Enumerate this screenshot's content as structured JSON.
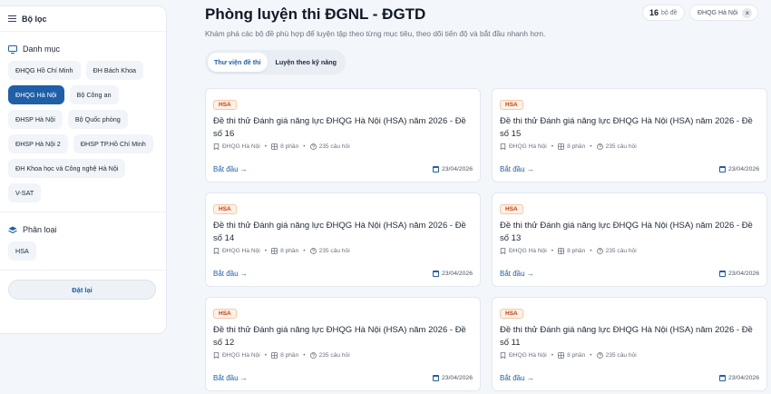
{
  "sidebar": {
    "header": "Bộ lọc",
    "category_title": "Danh mục",
    "categories": [
      {
        "label": "ĐHQG Hồ Chí Minh",
        "active": false
      },
      {
        "label": "ĐH Bách Khoa",
        "active": false
      },
      {
        "label": "ĐHQG Hà Nội",
        "active": true
      },
      {
        "label": "Bộ Công an",
        "active": false
      },
      {
        "label": "ĐHSP Hà Nội",
        "active": false
      },
      {
        "label": "Bộ Quốc phòng",
        "active": false
      },
      {
        "label": "ĐHSP Hà Nội 2",
        "active": false
      },
      {
        "label": "ĐHSP TP.Hồ Chí Minh",
        "active": false
      },
      {
        "label": "ĐH Khoa học và Công nghệ Hà Nội",
        "active": false
      },
      {
        "label": "V-SAT",
        "active": false
      }
    ],
    "classify_title": "Phân loại",
    "classify": [
      {
        "label": "HSA"
      }
    ],
    "reset_label": "Đặt lại"
  },
  "header": {
    "title": "Phòng luyện thi ĐGNL - ĐGTD",
    "subtitle": "Khám phá các bộ đề phù hợp để luyện tập theo từng mục tiêu, theo dõi tiến độ và bắt đầu nhanh hơn.",
    "count_value": "16",
    "count_unit": "bộ đề",
    "active_filter": "ĐHQG Hà Nội",
    "filter_close": "×"
  },
  "tabs": [
    {
      "label": "Thư viện đề thi",
      "active": true
    },
    {
      "label": "Luyện theo kỹ năng",
      "active": false
    }
  ],
  "cards": [
    {
      "tag": "HSA",
      "title": "Đề thi thử Đánh giá năng lực ĐHQG Hà Nội (HSA) năm 2026 - Đề số 16",
      "org": "ĐHQG Hà Nội",
      "parts": "8 phần",
      "questions": "235 câu hỏi",
      "start": "Bắt đầu →",
      "date": "23/04/2026"
    },
    {
      "tag": "HSA",
      "title": "Đề thi thử Đánh giá năng lực ĐHQG Hà Nội (HSA) năm 2026 - Đề số 15",
      "org": "ĐHQG Hà Nội",
      "parts": "8 phần",
      "questions": "235 câu hỏi",
      "start": "Bắt đầu →",
      "date": "23/04/2026"
    },
    {
      "tag": "HSA",
      "title": "Đề thi thử Đánh giá năng lực ĐHQG Hà Nội (HSA) năm 2026 - Đề số 14",
      "org": "ĐHQG Hà Nội",
      "parts": "8 phần",
      "questions": "235 câu hỏi",
      "start": "Bắt đầu →",
      "date": "23/04/2026"
    },
    {
      "tag": "HSA",
      "title": "Đề thi thử Đánh giá năng lực ĐHQG Hà Nội (HSA) năm 2026 - Đề số 13",
      "org": "ĐHQG Hà Nội",
      "parts": "8 phần",
      "questions": "235 câu hỏi",
      "start": "Bắt đầu →",
      "date": "23/04/2026"
    },
    {
      "tag": "HSA",
      "title": "Đề thi thử Đánh giá năng lực ĐHQG Hà Nội (HSA) năm 2026 - Đề số 12",
      "org": "ĐHQG Hà Nội",
      "parts": "8 phần",
      "questions": "235 câu hỏi",
      "start": "Bắt đầu →",
      "date": "23/04/2026"
    },
    {
      "tag": "HSA",
      "title": "Đề thi thử Đánh giá năng lực ĐHQG Hà Nội (HSA) năm 2026 - Đề số 11",
      "org": "ĐHQG Hà Nội",
      "parts": "8 phần",
      "questions": "235 câu hỏi",
      "start": "Bắt đầu →",
      "date": "23/04/2026"
    }
  ],
  "colors": {
    "accent": "#1f5fa8",
    "tag": "#c2410c",
    "background": "#f3f6fa"
  },
  "icons": {
    "filter": "menu-icon",
    "category": "monitor-icon",
    "classify": "layers-icon",
    "org": "bookmark-icon",
    "parts": "grid-icon",
    "questions": "help-circle-icon",
    "date": "calendar-icon"
  }
}
